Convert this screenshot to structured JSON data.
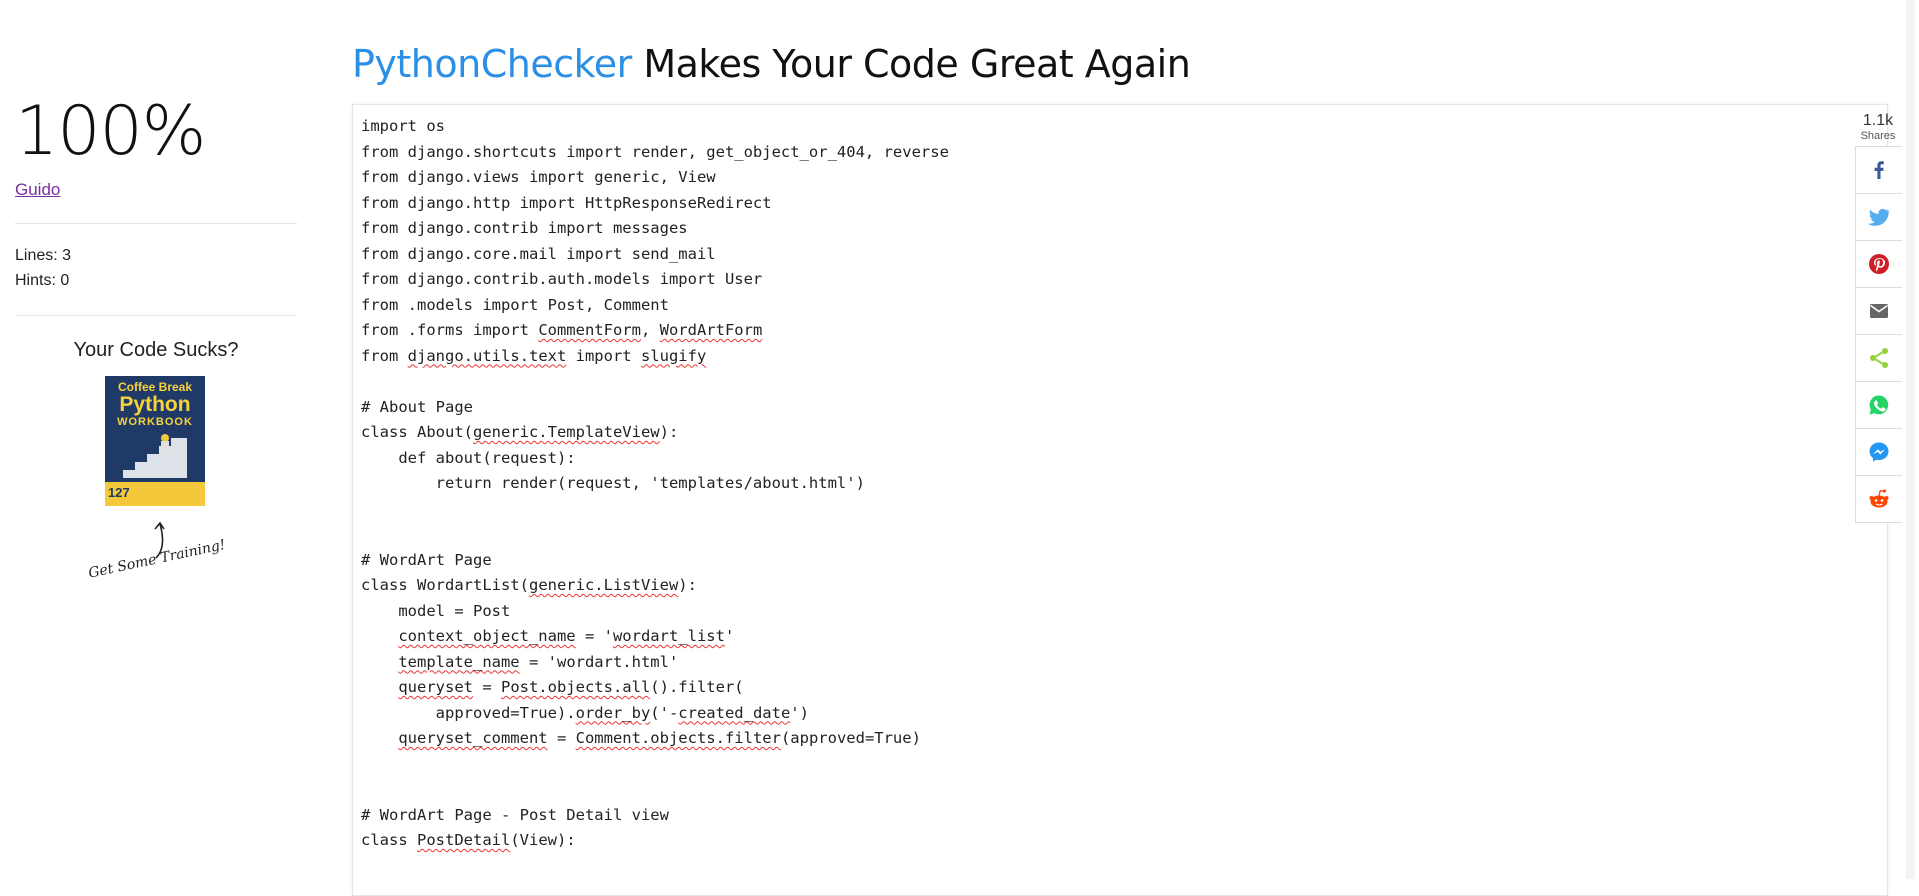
{
  "header": {
    "brand": "PythonChecker",
    "tagline": " Makes Your Code Great Again"
  },
  "sidebar": {
    "score": "100%",
    "user": "Guido",
    "lines": "Lines: 3",
    "hints": "Hints: 0",
    "promo_title": "Your Code Sucks?",
    "book": {
      "line1": "Coffee Break",
      "line2": "Python",
      "line3": "WORKBOOK",
      "number": "127"
    },
    "training": "Get Some Training!"
  },
  "share": {
    "count": "1.1k",
    "label": "Shares",
    "buttons": [
      "facebook-icon",
      "twitter-icon",
      "pinterest-icon",
      "email-icon",
      "share-icon",
      "whatsapp-icon",
      "messenger-icon",
      "reddit-icon"
    ],
    "colors": {
      "facebook": "#3b5998",
      "twitter": "#55acee",
      "pinterest": "#cb2027",
      "email": "#666666",
      "share": "#95d03a",
      "whatsapp": "#25d366",
      "messenger": "#2196f3",
      "reddit": "#ff4500"
    }
  },
  "code_lines": [
    "import os",
    "from django.shortcuts import render, get_object_or_404, reverse",
    "from django.views import generic, View",
    "from django.http import HttpResponseRedirect",
    "from django.contrib import messages",
    "from django.core.mail import send_mail",
    "from django.contrib.auth.models import User",
    "from .models import Post, Comment",
    "from .forms import CommentForm, WordArtForm",
    "from django.utils.text import slugify",
    "",
    "# About Page",
    "class About(generic.TemplateView):",
    "    def about(request):",
    "        return render(request, 'templates/about.html')",
    "",
    "",
    "# WordArt Page",
    "class WordartList(generic.ListView):",
    "    model = Post",
    "    context_object_name = 'wordart_list'",
    "    template_name = 'wordart.html'",
    "    queryset = Post.objects.all().filter(",
    "        approved=True).order_by('-created_date')",
    "    queryset_comment = Comment.objects.filter(approved=True)",
    "",
    "",
    "# WordArt Page - Post Detail view",
    "class PostDetail(View):"
  ],
  "code_errors": [
    "CommentForm",
    "WordArtForm",
    "django.utils.text",
    "slugify",
    "generic.TemplateView",
    "generic.ListView",
    "context_object_name",
    "wordart_list",
    "template_name",
    "queryset",
    "Post.objects.all",
    "order_by",
    "created_date",
    "queryset_comment",
    "Comment.objects.filter",
    "PostDetail"
  ]
}
